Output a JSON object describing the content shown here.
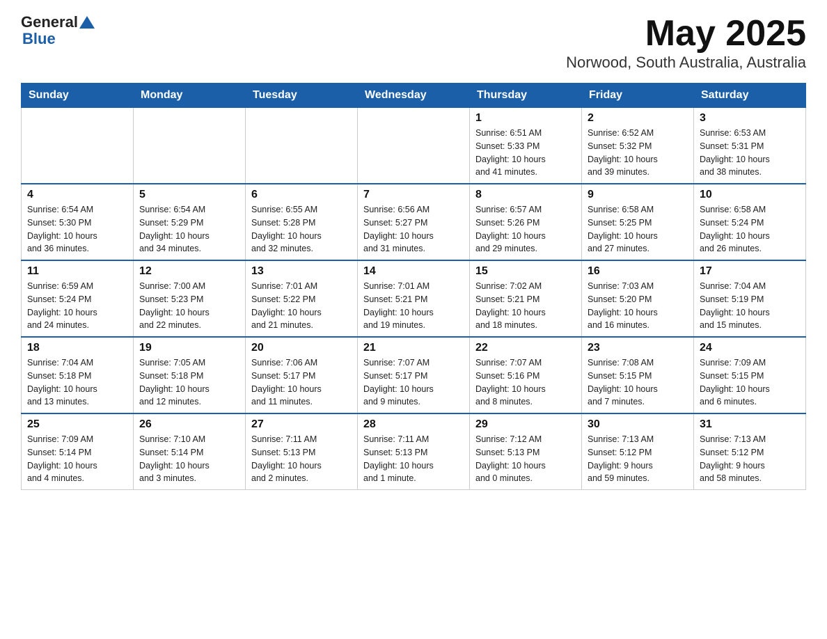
{
  "header": {
    "logo_general": "General",
    "logo_blue": "Blue",
    "title": "May 2025",
    "subtitle": "Norwood, South Australia, Australia"
  },
  "days_of_week": [
    "Sunday",
    "Monday",
    "Tuesday",
    "Wednesday",
    "Thursday",
    "Friday",
    "Saturday"
  ],
  "weeks": [
    [
      {
        "day": "",
        "info": ""
      },
      {
        "day": "",
        "info": ""
      },
      {
        "day": "",
        "info": ""
      },
      {
        "day": "",
        "info": ""
      },
      {
        "day": "1",
        "info": "Sunrise: 6:51 AM\nSunset: 5:33 PM\nDaylight: 10 hours\nand 41 minutes."
      },
      {
        "day": "2",
        "info": "Sunrise: 6:52 AM\nSunset: 5:32 PM\nDaylight: 10 hours\nand 39 minutes."
      },
      {
        "day": "3",
        "info": "Sunrise: 6:53 AM\nSunset: 5:31 PM\nDaylight: 10 hours\nand 38 minutes."
      }
    ],
    [
      {
        "day": "4",
        "info": "Sunrise: 6:54 AM\nSunset: 5:30 PM\nDaylight: 10 hours\nand 36 minutes."
      },
      {
        "day": "5",
        "info": "Sunrise: 6:54 AM\nSunset: 5:29 PM\nDaylight: 10 hours\nand 34 minutes."
      },
      {
        "day": "6",
        "info": "Sunrise: 6:55 AM\nSunset: 5:28 PM\nDaylight: 10 hours\nand 32 minutes."
      },
      {
        "day": "7",
        "info": "Sunrise: 6:56 AM\nSunset: 5:27 PM\nDaylight: 10 hours\nand 31 minutes."
      },
      {
        "day": "8",
        "info": "Sunrise: 6:57 AM\nSunset: 5:26 PM\nDaylight: 10 hours\nand 29 minutes."
      },
      {
        "day": "9",
        "info": "Sunrise: 6:58 AM\nSunset: 5:25 PM\nDaylight: 10 hours\nand 27 minutes."
      },
      {
        "day": "10",
        "info": "Sunrise: 6:58 AM\nSunset: 5:24 PM\nDaylight: 10 hours\nand 26 minutes."
      }
    ],
    [
      {
        "day": "11",
        "info": "Sunrise: 6:59 AM\nSunset: 5:24 PM\nDaylight: 10 hours\nand 24 minutes."
      },
      {
        "day": "12",
        "info": "Sunrise: 7:00 AM\nSunset: 5:23 PM\nDaylight: 10 hours\nand 22 minutes."
      },
      {
        "day": "13",
        "info": "Sunrise: 7:01 AM\nSunset: 5:22 PM\nDaylight: 10 hours\nand 21 minutes."
      },
      {
        "day": "14",
        "info": "Sunrise: 7:01 AM\nSunset: 5:21 PM\nDaylight: 10 hours\nand 19 minutes."
      },
      {
        "day": "15",
        "info": "Sunrise: 7:02 AM\nSunset: 5:21 PM\nDaylight: 10 hours\nand 18 minutes."
      },
      {
        "day": "16",
        "info": "Sunrise: 7:03 AM\nSunset: 5:20 PM\nDaylight: 10 hours\nand 16 minutes."
      },
      {
        "day": "17",
        "info": "Sunrise: 7:04 AM\nSunset: 5:19 PM\nDaylight: 10 hours\nand 15 minutes."
      }
    ],
    [
      {
        "day": "18",
        "info": "Sunrise: 7:04 AM\nSunset: 5:18 PM\nDaylight: 10 hours\nand 13 minutes."
      },
      {
        "day": "19",
        "info": "Sunrise: 7:05 AM\nSunset: 5:18 PM\nDaylight: 10 hours\nand 12 minutes."
      },
      {
        "day": "20",
        "info": "Sunrise: 7:06 AM\nSunset: 5:17 PM\nDaylight: 10 hours\nand 11 minutes."
      },
      {
        "day": "21",
        "info": "Sunrise: 7:07 AM\nSunset: 5:17 PM\nDaylight: 10 hours\nand 9 minutes."
      },
      {
        "day": "22",
        "info": "Sunrise: 7:07 AM\nSunset: 5:16 PM\nDaylight: 10 hours\nand 8 minutes."
      },
      {
        "day": "23",
        "info": "Sunrise: 7:08 AM\nSunset: 5:15 PM\nDaylight: 10 hours\nand 7 minutes."
      },
      {
        "day": "24",
        "info": "Sunrise: 7:09 AM\nSunset: 5:15 PM\nDaylight: 10 hours\nand 6 minutes."
      }
    ],
    [
      {
        "day": "25",
        "info": "Sunrise: 7:09 AM\nSunset: 5:14 PM\nDaylight: 10 hours\nand 4 minutes."
      },
      {
        "day": "26",
        "info": "Sunrise: 7:10 AM\nSunset: 5:14 PM\nDaylight: 10 hours\nand 3 minutes."
      },
      {
        "day": "27",
        "info": "Sunrise: 7:11 AM\nSunset: 5:13 PM\nDaylight: 10 hours\nand 2 minutes."
      },
      {
        "day": "28",
        "info": "Sunrise: 7:11 AM\nSunset: 5:13 PM\nDaylight: 10 hours\nand 1 minute."
      },
      {
        "day": "29",
        "info": "Sunrise: 7:12 AM\nSunset: 5:13 PM\nDaylight: 10 hours\nand 0 minutes."
      },
      {
        "day": "30",
        "info": "Sunrise: 7:13 AM\nSunset: 5:12 PM\nDaylight: 9 hours\nand 59 minutes."
      },
      {
        "day": "31",
        "info": "Sunrise: 7:13 AM\nSunset: 5:12 PM\nDaylight: 9 hours\nand 58 minutes."
      }
    ]
  ]
}
